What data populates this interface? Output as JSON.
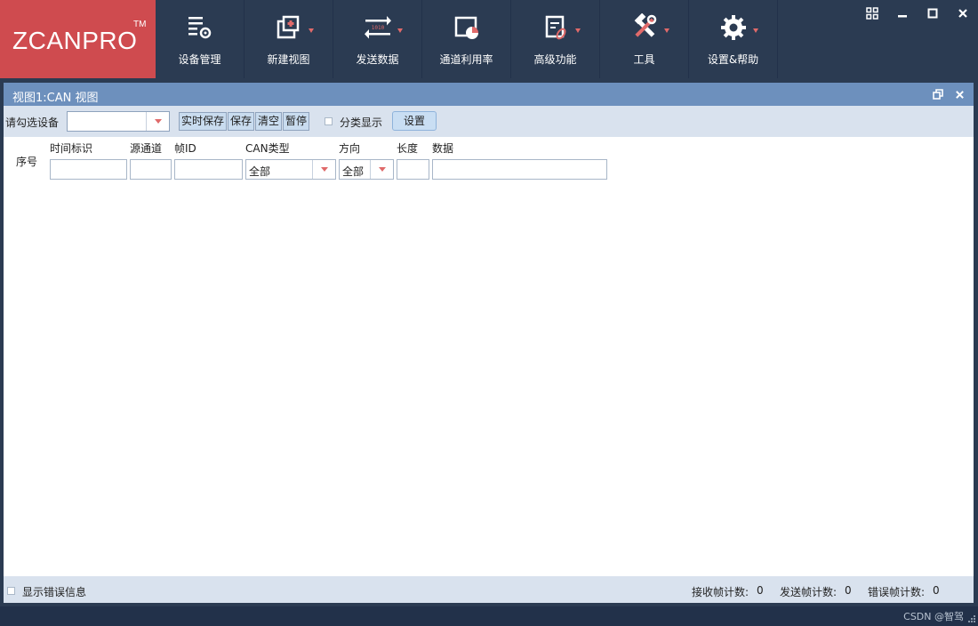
{
  "app": {
    "logo": "ZCANPRO",
    "logo_tm": "TM"
  },
  "nav": [
    {
      "label": "设备管理",
      "icon": "device-manage-icon",
      "dropdown": false
    },
    {
      "label": "新建视图",
      "icon": "new-view-icon",
      "dropdown": true
    },
    {
      "label": "发送数据",
      "icon": "send-data-icon",
      "dropdown": true
    },
    {
      "label": "通道利用率",
      "icon": "channel-usage-icon",
      "dropdown": false
    },
    {
      "label": "高级功能",
      "icon": "advanced-icon",
      "dropdown": true
    },
    {
      "label": "工具",
      "icon": "tools-icon",
      "dropdown": true
    },
    {
      "label": "设置&帮助",
      "icon": "gear-icon",
      "dropdown": true
    }
  ],
  "panel": {
    "title": "视图1:CAN 视图"
  },
  "toolbar": {
    "device_label": "请勾选设备",
    "device_value": "",
    "buttons": [
      "实时保存",
      "保存",
      "清空",
      "暂停"
    ],
    "classify_label": "分类显示",
    "classify_checked": false,
    "settings_label": "设置"
  },
  "columns": {
    "seq": "序号",
    "time": "时间标识",
    "src_channel": "源通道",
    "frame_id": "帧ID",
    "can_type": "CAN类型",
    "direction": "方向",
    "length": "长度",
    "data": "数据"
  },
  "filters": {
    "can_type": "全部",
    "direction": "全部"
  },
  "status": {
    "show_errors_label": "显示错误信息",
    "show_errors_checked": false,
    "rx_label": "接收帧计数:",
    "rx_count": "0",
    "tx_label": "发送帧计数:",
    "tx_count": "0",
    "err_label": "错误帧计数:",
    "err_count": "0"
  },
  "watermark": "CSDN @智驾",
  "colors": {
    "logo_bg": "#cf4b4f",
    "ribbon_bg": "#2b3b52",
    "panel_title_bg": "#6d90bd",
    "accent_arrow": "#e06a6a"
  }
}
